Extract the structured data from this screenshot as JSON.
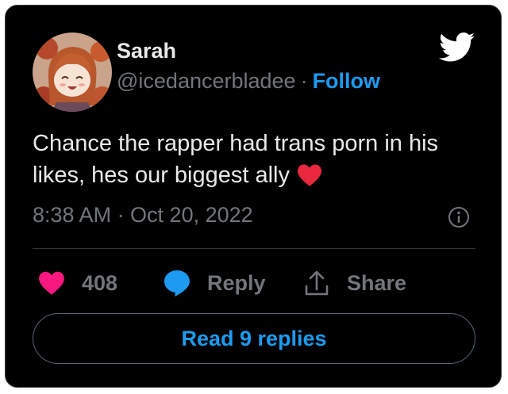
{
  "tweet": {
    "author": {
      "name": "Sarah",
      "handle": "@icedancerbladee",
      "separator": "·",
      "follow_label": "Follow"
    },
    "text": "Chance the rapper had trans porn in his likes, hes our biggest ally",
    "emoji": "red-heart",
    "timestamp": "8:38 AM · Oct 20, 2022",
    "actions": {
      "like_count": "408",
      "reply_label": "Reply",
      "share_label": "Share"
    },
    "read_replies_label": "Read 9 replies"
  },
  "icons": {
    "brand": "twitter-bird-icon",
    "info": "info-icon",
    "like": "heart-icon",
    "reply": "speech-bubble-icon",
    "share": "share-upload-icon"
  },
  "colors": {
    "background": "#000000",
    "text": "#e7e9ea",
    "secondary_text": "#71767b",
    "accent": "#1d9bf0",
    "like": "#f91880",
    "emoji_heart": "#e8283c",
    "border": "#536471"
  }
}
